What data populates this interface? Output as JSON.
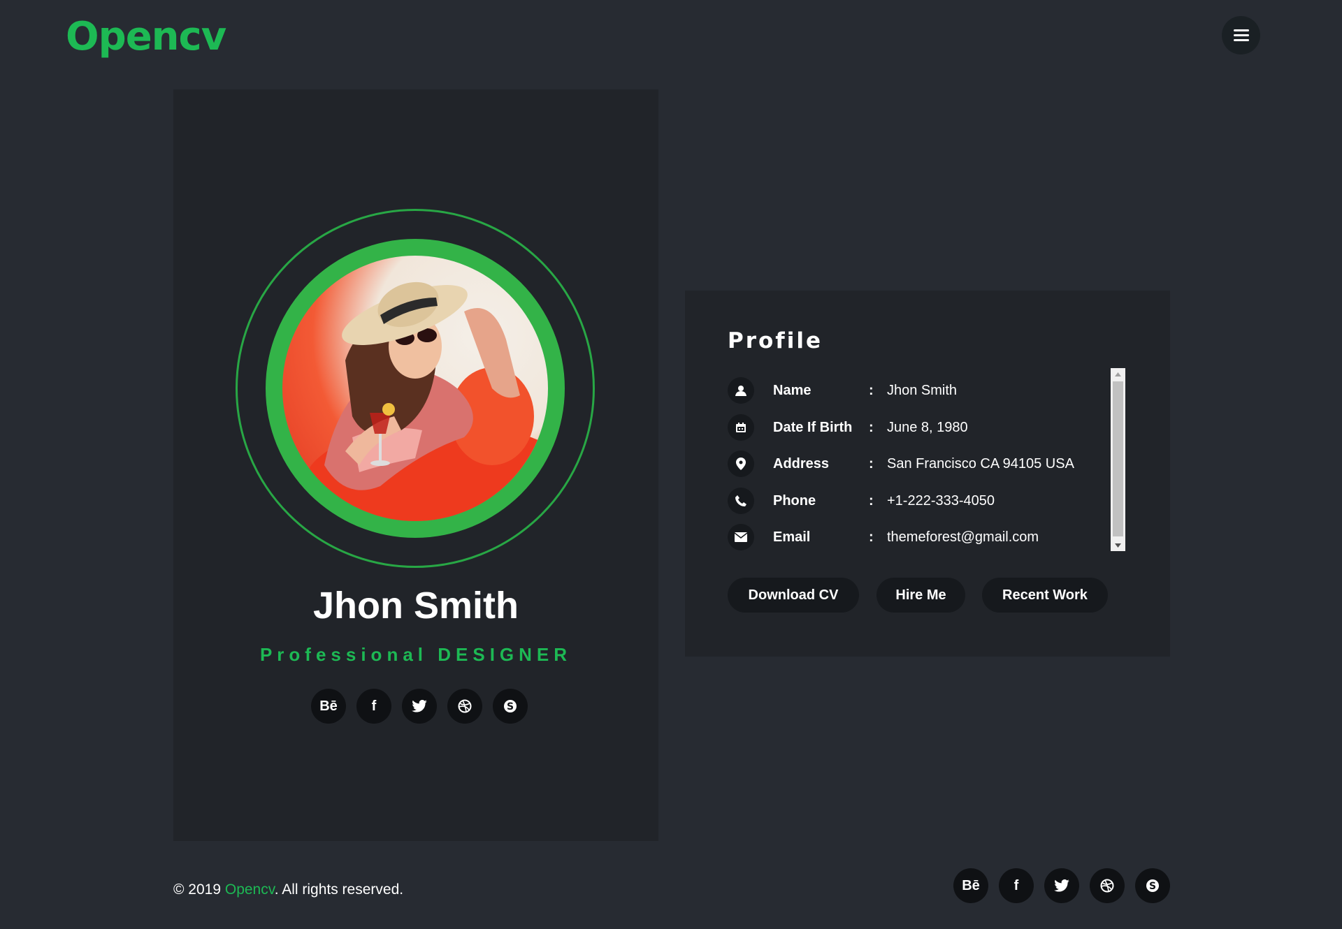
{
  "header": {
    "logo": "Opencv",
    "menu_icon": "hamburger-menu-icon"
  },
  "colors": {
    "accent": "#1db954",
    "background": "#272b32",
    "card": "#212429",
    "button": "#16191d"
  },
  "card": {
    "name": "Jhon Smith",
    "role": "Professional  DESIGNER",
    "social": [
      {
        "icon": "behance-icon",
        "label": "Bē"
      },
      {
        "icon": "facebook-icon",
        "label": "f"
      },
      {
        "icon": "twitter-icon",
        "label": ""
      },
      {
        "icon": "dribbble-icon",
        "label": ""
      },
      {
        "icon": "skype-icon",
        "label": ""
      }
    ]
  },
  "profile": {
    "title": "Profile",
    "rows": [
      {
        "icon": "user-icon",
        "label": "Name",
        "value": "Jhon Smith"
      },
      {
        "icon": "calendar-icon",
        "label": "Date If Birth",
        "value": "June 8, 1980"
      },
      {
        "icon": "map-pin-icon",
        "label": "Address",
        "value": "San Francisco CA 94105 USA"
      },
      {
        "icon": "phone-icon",
        "label": "Phone",
        "value": "+1-222-333-4050"
      },
      {
        "icon": "envelope-icon",
        "label": "Email",
        "value": "themeforest@gmail.com"
      }
    ],
    "buttons": {
      "download": "Download CV",
      "hire": "Hire Me",
      "recent": "Recent Work"
    }
  },
  "footer": {
    "copyright_prefix": "© 2019 ",
    "brand": "Opencv",
    "copyright_suffix": ". All rights reserved.",
    "social": [
      {
        "icon": "behance-icon",
        "label": "Bē"
      },
      {
        "icon": "facebook-icon",
        "label": "f"
      },
      {
        "icon": "twitter-icon",
        "label": ""
      },
      {
        "icon": "dribbble-icon",
        "label": ""
      },
      {
        "icon": "skype-icon",
        "label": ""
      }
    ]
  }
}
